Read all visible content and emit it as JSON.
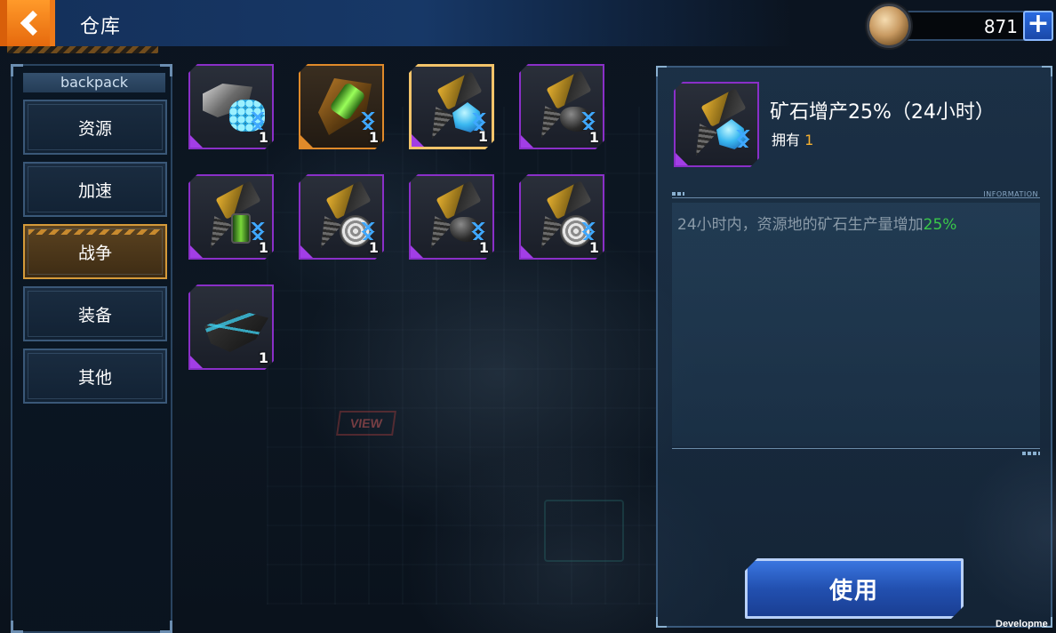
{
  "header": {
    "title": "仓库",
    "currency_amount": "871",
    "add_label": "+"
  },
  "sidebar": {
    "heading": "backpack",
    "categories": [
      {
        "label": "资源",
        "active": false
      },
      {
        "label": "加速",
        "active": false
      },
      {
        "label": "战争",
        "active": true
      },
      {
        "label": "装备",
        "active": false
      },
      {
        "label": "其他",
        "active": false
      }
    ]
  },
  "items": [
    {
      "qty": "1",
      "art": "mech-with-blue-eggs",
      "frame": "purple"
    },
    {
      "qty": "1",
      "art": "orange-drill-green-core",
      "frame": "orange"
    },
    {
      "qty": "1",
      "art": "hammer-blue-crystal",
      "frame": "purple",
      "selected": true
    },
    {
      "qty": "1",
      "art": "hammer-black-ore",
      "frame": "purple"
    },
    {
      "qty": "1",
      "art": "hammer-green-canister",
      "frame": "purple"
    },
    {
      "qty": "1",
      "art": "hammer-silver-disc",
      "frame": "purple"
    },
    {
      "qty": "1",
      "art": "hammer-black-ore",
      "frame": "purple"
    },
    {
      "qty": "1",
      "art": "hammer-silver-disc",
      "frame": "purple"
    },
    {
      "qty": "1",
      "art": "blue-spaceship",
      "frame": "purple"
    }
  ],
  "detail": {
    "name": "矿石增产25%（24小时）",
    "own_label": "拥有",
    "own_count": "1",
    "info_label": "INFORMATION",
    "description_prefix": "24小时内，资源地的矿石生产量增加",
    "description_highlight": "25%",
    "use_button": "使用"
  },
  "footer": {
    "dev_text": "Developme"
  },
  "colors": {
    "purple_frame": "#8a2fc8",
    "orange_frame": "#e08a2a",
    "selected_frame": "#f3c46a",
    "highlight_green": "#3ac84a",
    "count_orange": "#f5b030",
    "use_button_blue": "#2a5fc8"
  }
}
